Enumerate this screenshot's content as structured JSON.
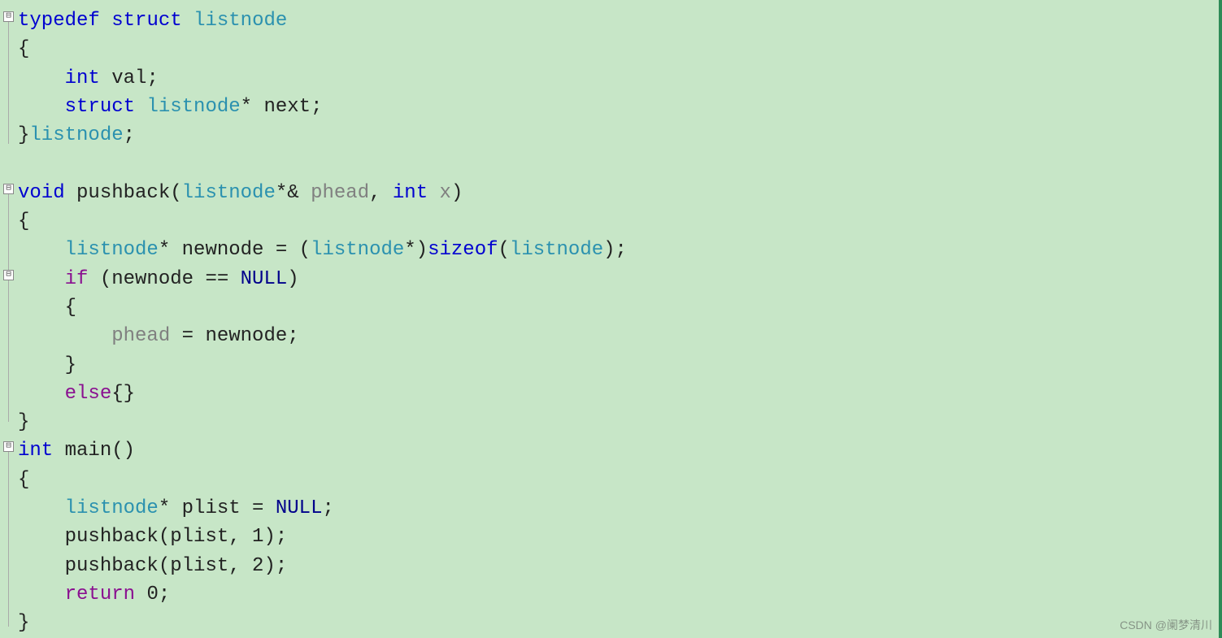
{
  "fold_glyph": "⊟",
  "lines": {
    "l1": {
      "t1": "typedef",
      "t2": "struct",
      "t3": "listnode"
    },
    "l2": "{",
    "l3": {
      "indent": "    ",
      "t1": "int",
      "t2": " val;"
    },
    "l4": {
      "indent": "    ",
      "t1": "struct",
      "t2": "listnode",
      "t3": "* next;"
    },
    "l5": {
      "pre": "}",
      "t1": "listnode",
      "post": ";"
    },
    "l6": "",
    "l7": {
      "t1": "void",
      "t2": " pushback(",
      "t3": "listnode",
      "t4": "*& ",
      "t5": "phead",
      "t6": ", ",
      "t7": "int",
      "t8": " ",
      "t9": "x",
      "t10": ")"
    },
    "l8": "{",
    "l9": {
      "indent": "    ",
      "t1": "listnode",
      "t2": "* newnode = (",
      "t3": "listnode",
      "t4": "*)",
      "t5": "sizeof",
      "t6": "(",
      "t7": "listnode",
      "t8": ");"
    },
    "l10": {
      "indent": "    ",
      "t1": "if",
      "t2": " (newnode == ",
      "t3": "NULL",
      "t4": ")"
    },
    "l11": "    {",
    "l12": {
      "indent": "        ",
      "t1": "phead",
      "t2": " = newnode;"
    },
    "l13": "    }",
    "l14": {
      "indent": "    ",
      "t1": "else",
      "t2": "{}"
    },
    "l15": "}",
    "l16": {
      "t1": "int",
      "t2": " main()"
    },
    "l17": "{",
    "l18": {
      "indent": "    ",
      "t1": "listnode",
      "t2": "* plist = ",
      "t3": "NULL",
      "t4": ";"
    },
    "l19": {
      "indent": "    ",
      "t1": "pushback(plist, ",
      "t2": "1",
      "t3": ");"
    },
    "l20": {
      "indent": "    ",
      "t1": "pushback(plist, ",
      "t2": "2",
      "t3": ");"
    },
    "l21": {
      "indent": "    ",
      "t1": "return",
      "t2": " ",
      "t3": "0",
      "t4": ";"
    },
    "l22": "}"
  },
  "watermark": "CSDN @阑梦清川"
}
